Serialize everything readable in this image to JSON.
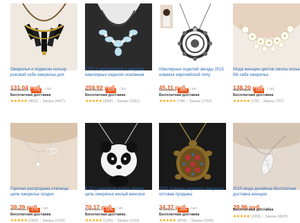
{
  "products": [
    {
      "title": "Ожерелья и подвески кольер роковой себе ожерелье для",
      "price": "131,04 руб.",
      "unit": "/ шт.",
      "old_price": "469,52 руб.",
      "discount": "-72%",
      "shipping": "Бесплатная доставка",
      "reviews": "(4602)",
      "orders": "Заказы (4467)"
    },
    {
      "title": "1743 # европейский и америка ювелирных изделия основным",
      "price": "259,92 руб.",
      "unit": "/ шт.",
      "old_price": "530,46 руб.",
      "discount": "-51%",
      "shipping": "Бесплатная доставка",
      "reviews": "(3096)",
      "orders": "Заказы (2091)"
    },
    {
      "title": "Ювелирных изделий звезды 2015 новинка европейской попу",
      "price": "45,11 руб.",
      "unit": "/ шт.",
      "old_price": "62,45 руб.",
      "discount": "-28%",
      "shipping": "Бесплатная доставка",
      "reviews": "(744)",
      "orders": "Заказы (2744)"
    },
    {
      "title": "Мода женщин цветов смолы колье бib себе ожерелье",
      "price": "138,20 руб.",
      "unit": "/ шт.",
      "old_price": "168,54 руб.",
      "discount": "-18%",
      "shipping": "Бесплатная доставка",
      "reviews": "(178)",
      "orders": "Заказы (797)"
    },
    {
      "title": "Горячая распродажа ключицы цепи ожерелье поздно",
      "price": "39,39 руб.",
      "unit": "/ шт.",
      "old_price": "47,46 руб.",
      "discount": "-17%",
      "shipping": "Бесплатная доставка",
      "reviews": "(2469)",
      "orders": "Заказы (2155)"
    },
    {
      "title": "$ 10 () имитация алмаз свитер цепь ожерелье милый женское",
      "price": "70,17 руб.",
      "unit": "/ шт.",
      "old_price": "83,54 руб.",
      "discount": "-16%",
      "shipping": "Бесплатная доставка",
      "reviews": "(1245)",
      "orders": "Заказы (1163)"
    },
    {
      "title": "2015 новинка черепаха ожерелье оптовая продажа",
      "price": "34,37 руб.",
      "unit": "/ шт.",
      "old_price": "42,96 руб.",
      "discount": "-20%",
      "shipping": "Бесплатная доставка",
      "reviews": "(4055)",
      "orders": "Заказы (3049)"
    },
    {
      "title": "2015 мода дизайнер бесплатная доставка женщин",
      "price": "29,96 руб.",
      "unit": "/ шт.",
      "old_price": "",
      "discount": "",
      "shipping": "Бесплатная доставка",
      "reviews": "(3355)",
      "orders": "Заказы (4629)"
    }
  ],
  "stars": "★★★★★",
  "separator": "|",
  "colors": {
    "price": "#e8561c",
    "title_link": "#2a6ab7",
    "star": "#f0a30a"
  }
}
